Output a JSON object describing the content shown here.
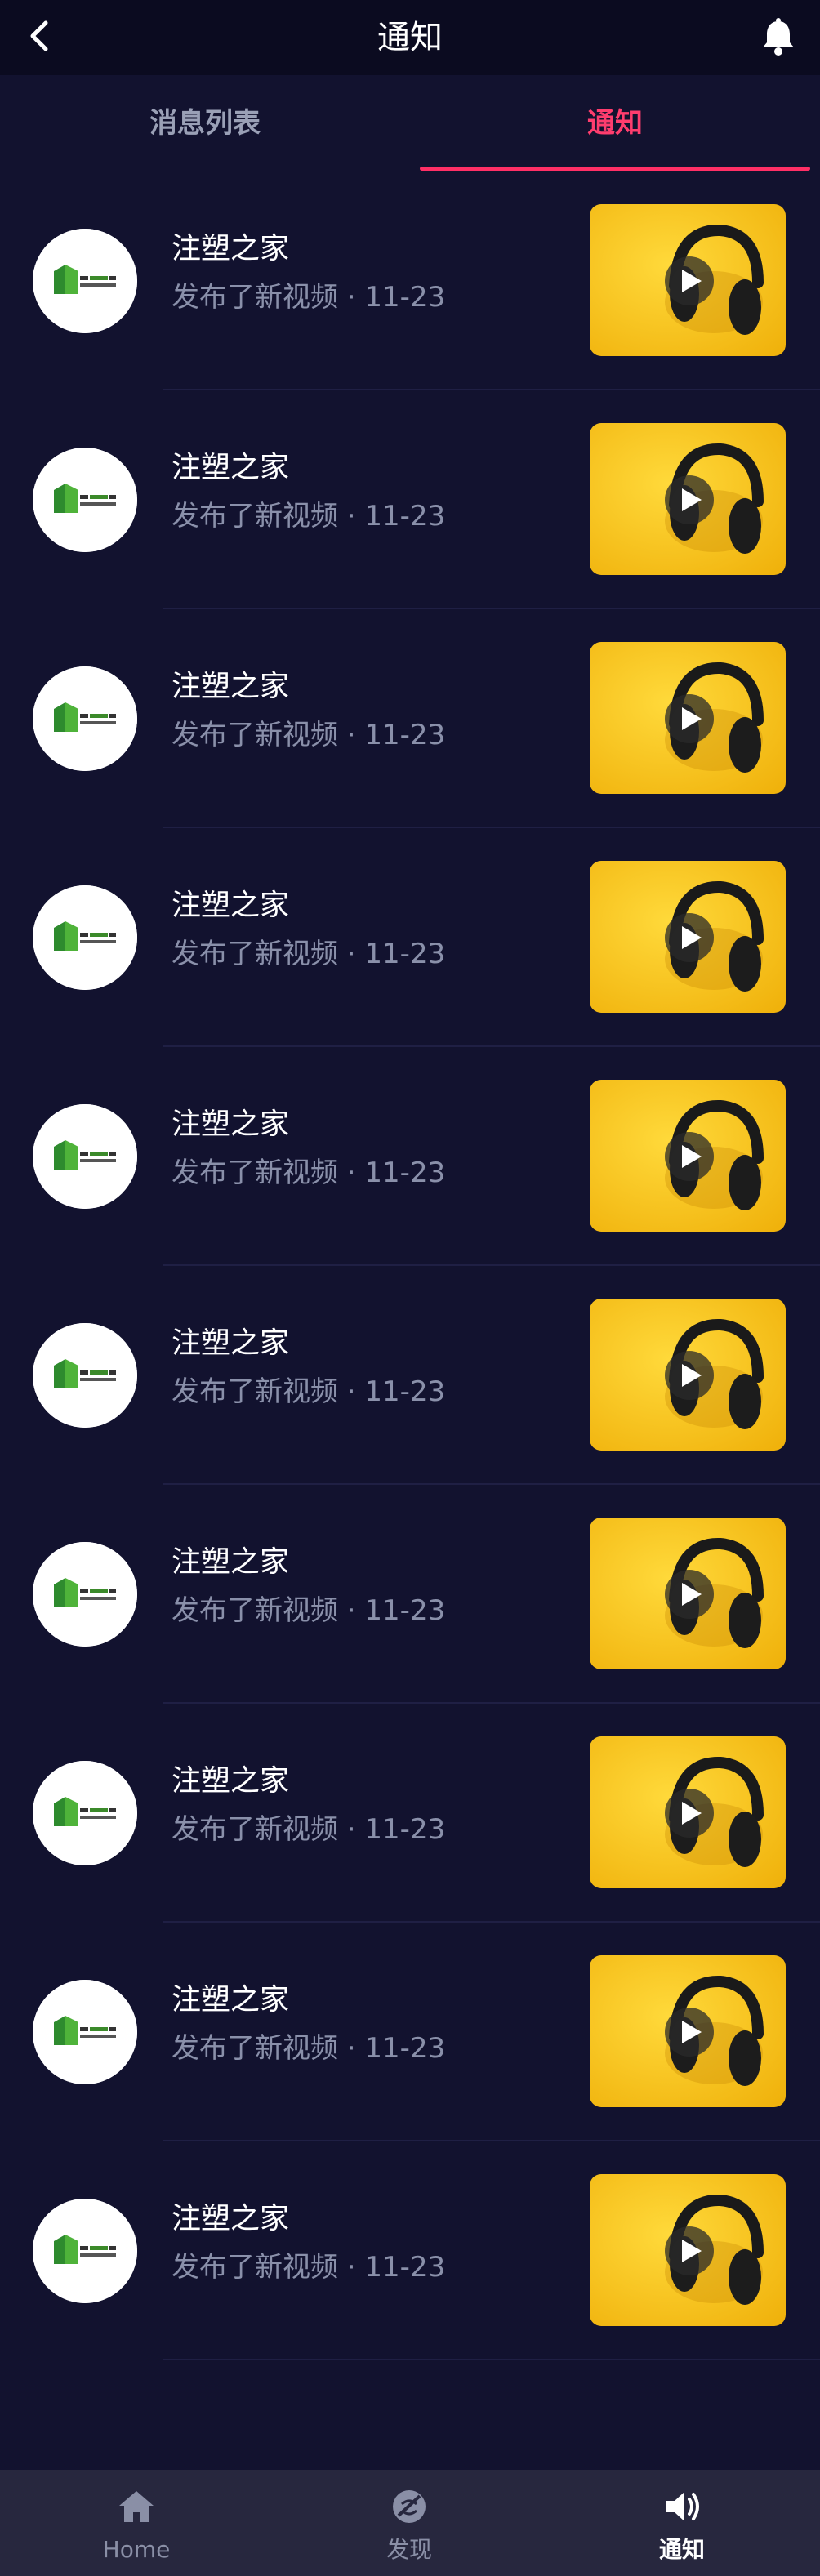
{
  "header": {
    "title": "通知",
    "back_icon": "chevron-left-icon",
    "bell_icon": "bell-icon"
  },
  "tabs": [
    {
      "label": "消息列表",
      "active": false
    },
    {
      "label": "通知",
      "active": true
    }
  ],
  "colors": {
    "background": "#12122f",
    "accent": "#ff2f66",
    "thumbnail_yellow": "#f8c41a",
    "subtitle_gray": "#8a90aa"
  },
  "notifications": [
    {
      "title": "注塑之家",
      "subtitle": "发布了新视频 · 11-23"
    },
    {
      "title": "注塑之家",
      "subtitle": "发布了新视频 · 11-23"
    },
    {
      "title": "注塑之家",
      "subtitle": "发布了新视频 · 11-23"
    },
    {
      "title": "注塑之家",
      "subtitle": "发布了新视频 · 11-23"
    },
    {
      "title": "注塑之家",
      "subtitle": "发布了新视频 · 11-23"
    },
    {
      "title": "注塑之家",
      "subtitle": "发布了新视频 · 11-23"
    },
    {
      "title": "注塑之家",
      "subtitle": "发布了新视频 · 11-23"
    },
    {
      "title": "注塑之家",
      "subtitle": "发布了新视频 · 11-23"
    },
    {
      "title": "注塑之家",
      "subtitle": "发布了新视频 · 11-23"
    },
    {
      "title": "注塑之家",
      "subtitle": "发布了新视频 · 11-23"
    }
  ],
  "bottom_nav": [
    {
      "label": "Home",
      "icon": "home-icon",
      "active": false
    },
    {
      "label": "发现",
      "icon": "discover-icon",
      "active": false
    },
    {
      "label": "通知",
      "icon": "speaker-icon",
      "active": true
    }
  ]
}
